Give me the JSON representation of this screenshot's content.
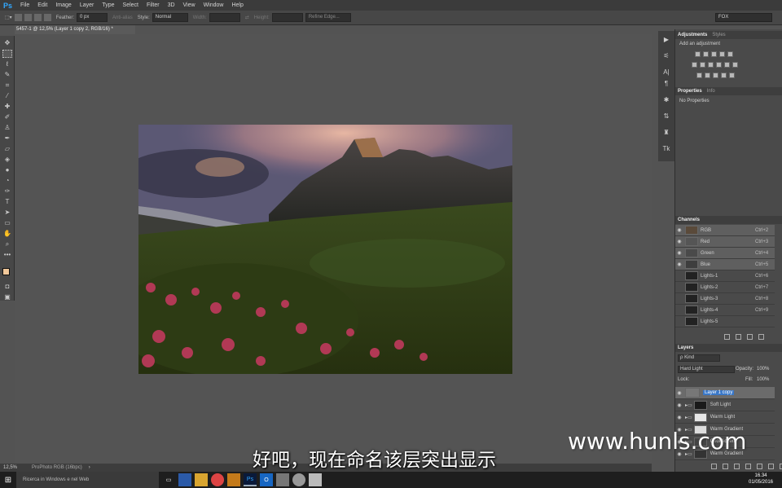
{
  "app": {
    "logo": "Ps"
  },
  "menu": [
    "File",
    "Edit",
    "Image",
    "Layer",
    "Type",
    "Select",
    "Filter",
    "3D",
    "View",
    "Window",
    "Help"
  ],
  "options": {
    "feather_label": "Feather:",
    "feather_value": "0 px",
    "antialias": "Anti-alias",
    "style_label": "Style:",
    "style_value": "Normal",
    "width_label": "Width:",
    "height_label": "Height:",
    "refine": "Refine Edge...",
    "workspace": "FOX"
  },
  "document": {
    "tab": "5457-1 @ 12,5% (Layer 1 copy 2, RGB/16) *"
  },
  "status": {
    "zoom": "12,5%",
    "profile": "ProPhoto RGB (16bpc)"
  },
  "adjustments": {
    "tabs": [
      "Adjustments",
      "Styles"
    ],
    "hint": "Add an adjustment",
    "icon_colors": {
      "active": "#b8b8b8"
    }
  },
  "properties": {
    "tabs": [
      "Properties",
      "Info"
    ],
    "message": "No Properties"
  },
  "channels": {
    "tab": "Channels",
    "items": [
      {
        "name": "RGB",
        "shortcut": "Ctrl+2"
      },
      {
        "name": "Red",
        "shortcut": "Ctrl+3"
      },
      {
        "name": "Green",
        "shortcut": "Ctrl+4"
      },
      {
        "name": "Blue",
        "shortcut": "Ctrl+5"
      },
      {
        "name": "Lights-1",
        "shortcut": "Ctrl+6"
      },
      {
        "name": "Lights-2",
        "shortcut": "Ctrl+7"
      },
      {
        "name": "Lights-3",
        "shortcut": "Ctrl+8"
      },
      {
        "name": "Lights-4",
        "shortcut": "Ctrl+9"
      },
      {
        "name": "Lights-5",
        "shortcut": ""
      }
    ]
  },
  "layers": {
    "tab": "Layers",
    "filter": "ρ Kind",
    "blend_mode": "Hard Light",
    "opacity_label": "Opacity:",
    "opacity_value": "100%",
    "lock_label": "Lock:",
    "fill_label": "Fill:",
    "fill_value": "100%",
    "items": [
      {
        "name": "Layer 1 copy"
      },
      {
        "name": "Soft Light"
      },
      {
        "name": "Warm Light"
      },
      {
        "name": "Warm Gradient"
      },
      {
        "name": "Cool Accent"
      },
      {
        "name": "Warm Gradient"
      }
    ]
  },
  "taskbar": {
    "search": "Ricerca in Windows e nel Web",
    "time": "16.34",
    "date": "01/05/2016"
  },
  "overlay": {
    "subtitle": "好吧，现在命名该层突出显示",
    "watermark": "www.hunls.com"
  }
}
